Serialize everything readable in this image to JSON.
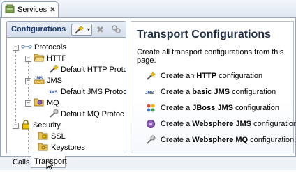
{
  "editor_tab": {
    "title": "Services",
    "close": "✖"
  },
  "left_pane": {
    "title": "Configurations",
    "dropdown_arrow": "▾",
    "delete_glyph": "✖",
    "tree": {
      "protocols": "Protocols",
      "http": "HTTP",
      "http_default": "Default HTTP Proto",
      "jms": "JMS",
      "jms_default": "Default JMS Protoc",
      "mq": "MQ",
      "mq_default": "Default MQ Protoc",
      "security": "Security",
      "ssl": "SSL",
      "keystores": "Keystores"
    },
    "expander_minus": "−"
  },
  "right_pane": {
    "title": "Transport Configurations",
    "subtitle": "Create all transport configurations from this page.",
    "links": [
      {
        "pre": "Create an ",
        "bold": "HTTP",
        "post": " configuration",
        "icon": "http-wand-icon"
      },
      {
        "pre": "Create a ",
        "bold": "basic JMS",
        "post": " configuration",
        "icon": "jms-icon"
      },
      {
        "pre": "Create a ",
        "bold": "JBoss JMS",
        "post": " configuration",
        "icon": "jboss-icon"
      },
      {
        "pre": "Create a ",
        "bold": "Websphere JMS",
        "post": " configuration",
        "icon": "websphere-jms-icon"
      },
      {
        "pre": "Create a ",
        "bold": "Websphere MQ",
        "post": " configuration.",
        "icon": "websphere-mq-icon"
      }
    ]
  },
  "bottom_tabs": {
    "calls": "Calls",
    "transport": "Transport"
  },
  "icon_labels": {
    "jms": "JMS"
  },
  "colors": {
    "title_blue": "#1a3a72",
    "folder": "#e8c35a",
    "frame": "#9aa7bb"
  }
}
